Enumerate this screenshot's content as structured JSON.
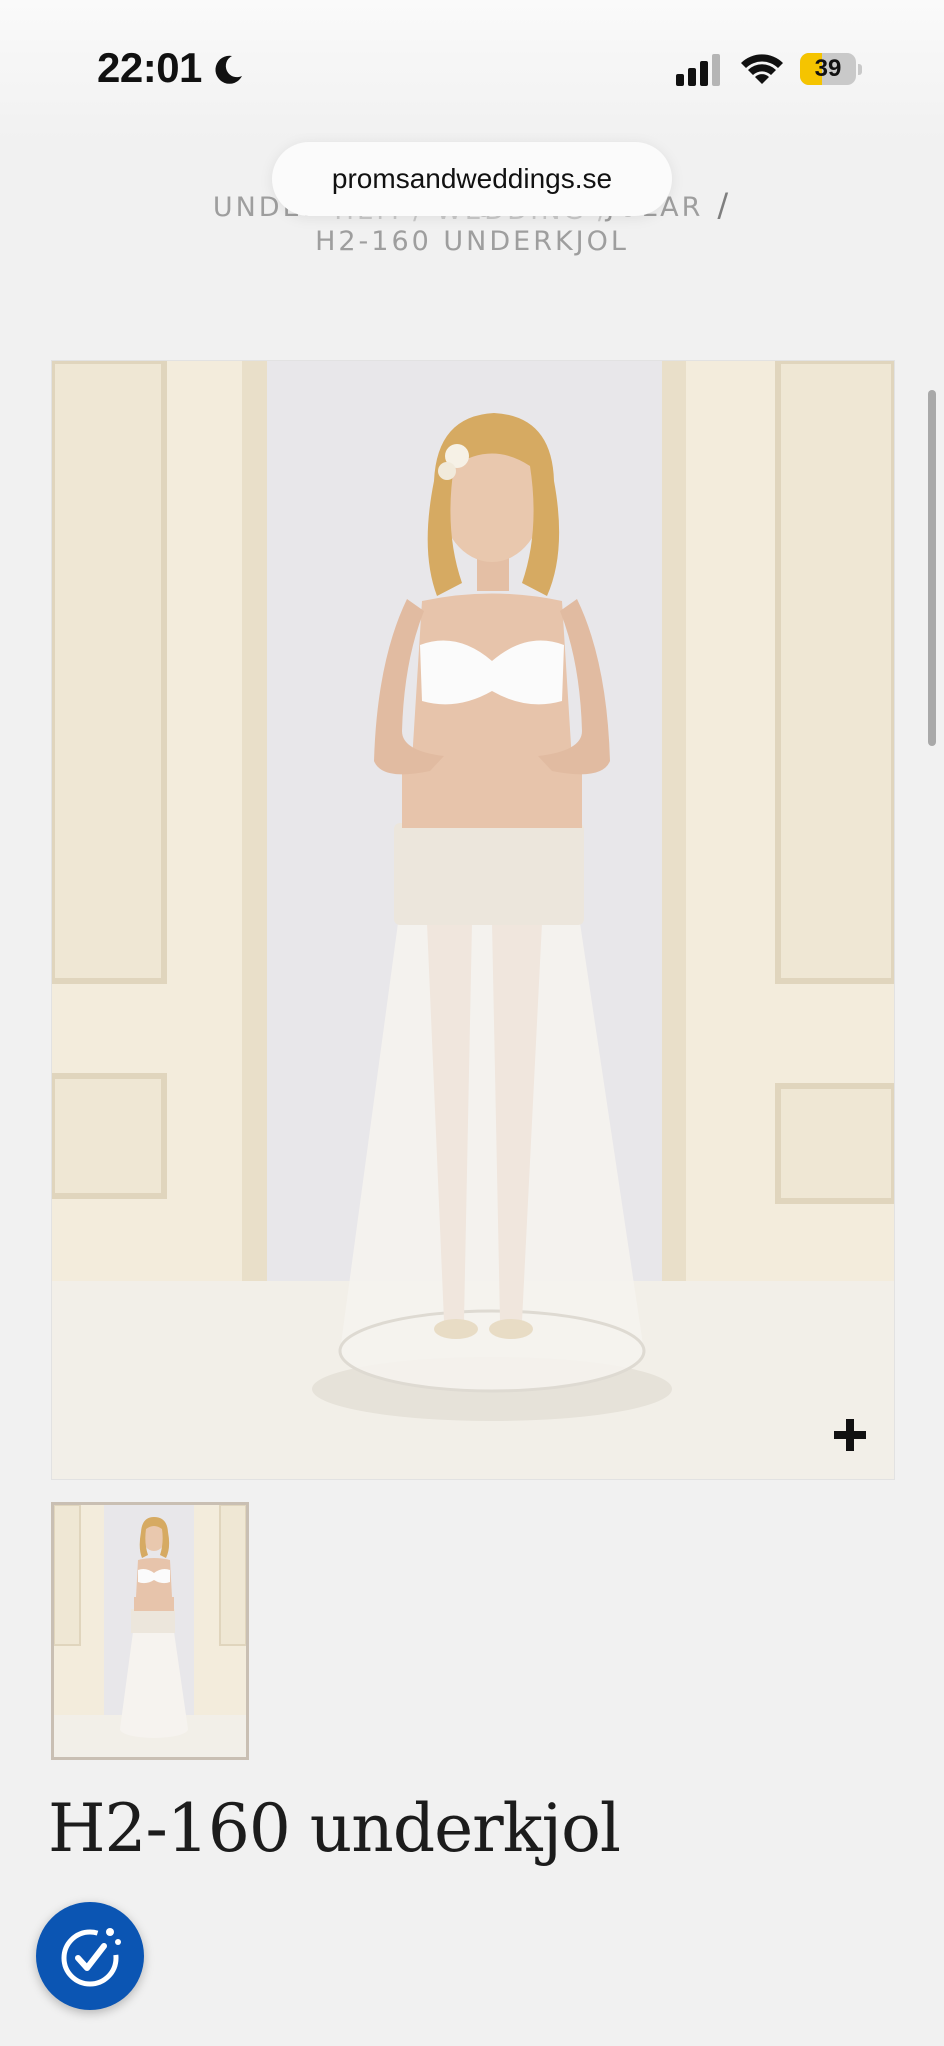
{
  "status_bar": {
    "time": "22:01",
    "battery_percent": "39",
    "battery_level": 0.39
  },
  "browser": {
    "url": "promsandweddings.se"
  },
  "breadcrumb": {
    "hidden_line": "HEM / WEDDING /",
    "line1": "UNDERKLÄDER,  UNDERKJOLAR",
    "separator": "/",
    "line2": "H2-160 UNDERKJOL"
  },
  "product": {
    "title": "H2-160 underkjol",
    "zoom_icon": "plus-icon"
  },
  "accessibility": {
    "icon": "accessibility-check-icon"
  },
  "colors": {
    "background": "#f1f1f1",
    "accent_blue": "#0b55b3",
    "battery_yellow": "#f5c400"
  }
}
